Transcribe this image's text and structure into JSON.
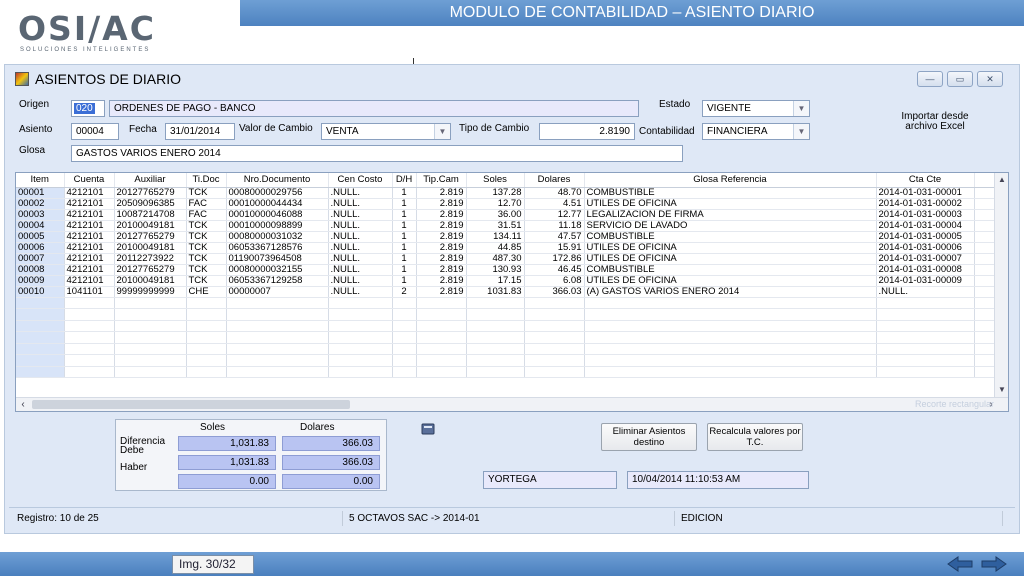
{
  "slide": {
    "logo_text": "OSI/AC",
    "logo_tagline": "SOLUCIONES INTELIGENTES",
    "module_title": "MODULO DE CONTABILIDAD – ASIENTO DIARIO",
    "image_label": "Img. 30/32"
  },
  "window": {
    "title": "ASIENTOS DE DIARIO",
    "controls": [
      "—",
      "▭",
      "✕"
    ]
  },
  "form": {
    "origen_label": "Origen",
    "origen_code": "020",
    "origen_desc": "ORDENES DE PAGO - BANCO",
    "estado_label": "Estado",
    "estado_value": "VIGENTE",
    "asiento_label": "Asiento",
    "asiento_value": "00004",
    "fecha_label": "Fecha",
    "fecha_value": "31/01/2014",
    "valor_cambio_label": "Valor de Cambio",
    "valor_cambio_value": "VENTA",
    "tipo_cambio_label": "Tipo de Cambio",
    "tipo_cambio_value": "2.8190",
    "contabilidad_label": "Contabilidad",
    "contabilidad_value": "FINANCIERA",
    "glosa_label": "Glosa",
    "glosa_value": "GASTOS VARIOS ENERO 2014",
    "import_label": "Importar desde archivo Excel"
  },
  "grid": {
    "columns": [
      "Item",
      "Cuenta",
      "Auxiliar",
      "Ti.Doc",
      "Nro.Documento",
      "Cen Costo",
      "D/H",
      "Tip.Cam",
      "Soles",
      "Dolares",
      "Glosa Referencia",
      "Cta Cte"
    ],
    "rows": [
      [
        "00001",
        "4212101",
        "20127765279",
        "TCK",
        "00080000029756",
        ".NULL.",
        "1",
        "2.819",
        "137.28",
        "48.70",
        "COMBUSTIBLE",
        "2014-01-031-00001"
      ],
      [
        "00002",
        "4212101",
        "20509096385",
        "FAC",
        "00010000044434",
        ".NULL.",
        "1",
        "2.819",
        "12.70",
        "4.51",
        "UTILES DE OFICINA",
        "2014-01-031-00002"
      ],
      [
        "00003",
        "4212101",
        "10087214708",
        "FAC",
        "00010000046088",
        ".NULL.",
        "1",
        "2.819",
        "36.00",
        "12.77",
        "LEGALIZACION DE FIRMA",
        "2014-01-031-00003"
      ],
      [
        "00004",
        "4212101",
        "20100049181",
        "TCK",
        "00010000098899",
        ".NULL.",
        "1",
        "2.819",
        "31.51",
        "11.18",
        "SERVICIO DE LAVADO",
        "2014-01-031-00004"
      ],
      [
        "00005",
        "4212101",
        "20127765279",
        "TCK",
        "00080000031032",
        ".NULL.",
        "1",
        "2.819",
        "134.11",
        "47.57",
        "COMBUSTIBLE",
        "2014-01-031-00005"
      ],
      [
        "00006",
        "4212101",
        "20100049181",
        "TCK",
        "06053367128576",
        ".NULL.",
        "1",
        "2.819",
        "44.85",
        "15.91",
        "UTILES DE OFICINA",
        "2014-01-031-00006"
      ],
      [
        "00007",
        "4212101",
        "20112273922",
        "TCK",
        "01190073964508",
        ".NULL.",
        "1",
        "2.819",
        "487.30",
        "172.86",
        "UTILES DE OFICINA",
        "2014-01-031-00007"
      ],
      [
        "00008",
        "4212101",
        "20127765279",
        "TCK",
        "00080000032155",
        ".NULL.",
        "1",
        "2.819",
        "130.93",
        "46.45",
        "COMBUSTIBLE",
        "2014-01-031-00008"
      ],
      [
        "00009",
        "4212101",
        "20100049181",
        "TCK",
        "06053367129258",
        ".NULL.",
        "1",
        "2.819",
        "17.15",
        "6.08",
        "UTILES DE OFICINA",
        "2014-01-031-00009"
      ],
      [
        "00010",
        "1041101",
        "99999999999",
        "CHE",
        "00000007",
        ".NULL.",
        "2",
        "2.819",
        "1031.83",
        "366.03",
        "(A) GASTOS VARIOS ENERO 2014",
        ".NULL."
      ]
    ],
    "ghost_text": "Recorte rectangular"
  },
  "totals": {
    "soles_header": "Soles",
    "dolares_header": "Dolares",
    "diferencia_label": "Diferencia",
    "debe_label": "Debe",
    "haber_label": "Haber",
    "debe_soles": "1,031.83",
    "debe_dolares": "366.03",
    "haber_soles": "1,031.83",
    "haber_dolares": "366.03",
    "dif_soles": "0.00",
    "dif_dolares": "0.00"
  },
  "actions": {
    "eliminar_label": "Eliminar Asientos destino",
    "recalcula_label": "Recalcula valores por T.C.",
    "user_value": "YORTEGA",
    "timestamp_value": "10/04/2014 11:10:53 AM"
  },
  "status": {
    "registro": "Registro: 10 de 25",
    "empresa": "5 OCTAVOS SAC -> 2014-01",
    "modo": "EDICION"
  }
}
